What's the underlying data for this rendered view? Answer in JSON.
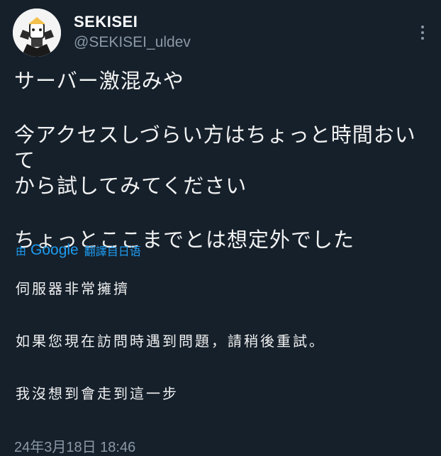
{
  "author": {
    "display_name": "SEKISEI",
    "handle": "@SEKISEI_uldev"
  },
  "tweet": {
    "lines": [
      "サーバー激混みや",
      "今アクセスしづらい方はちょっと時間おいて",
      "から試してみてください",
      "ちょっとここまでとは想定外でした"
    ]
  },
  "translation_label": {
    "by": "由",
    "engine": "Google",
    "rest": "翻譯自日语"
  },
  "translation": {
    "lines": [
      "伺服器非常擁擠",
      "如果您現在訪問時遇到問題，請稍後重試。",
      "我沒想到會走到這一步"
    ]
  },
  "timestamp": "24年3月18日 18:46",
  "colors": {
    "background": "#15202b",
    "accent": "#1d9bf0",
    "secondary_text": "#8b98a5"
  },
  "icons": {
    "more": "more-horizontal-icon"
  }
}
